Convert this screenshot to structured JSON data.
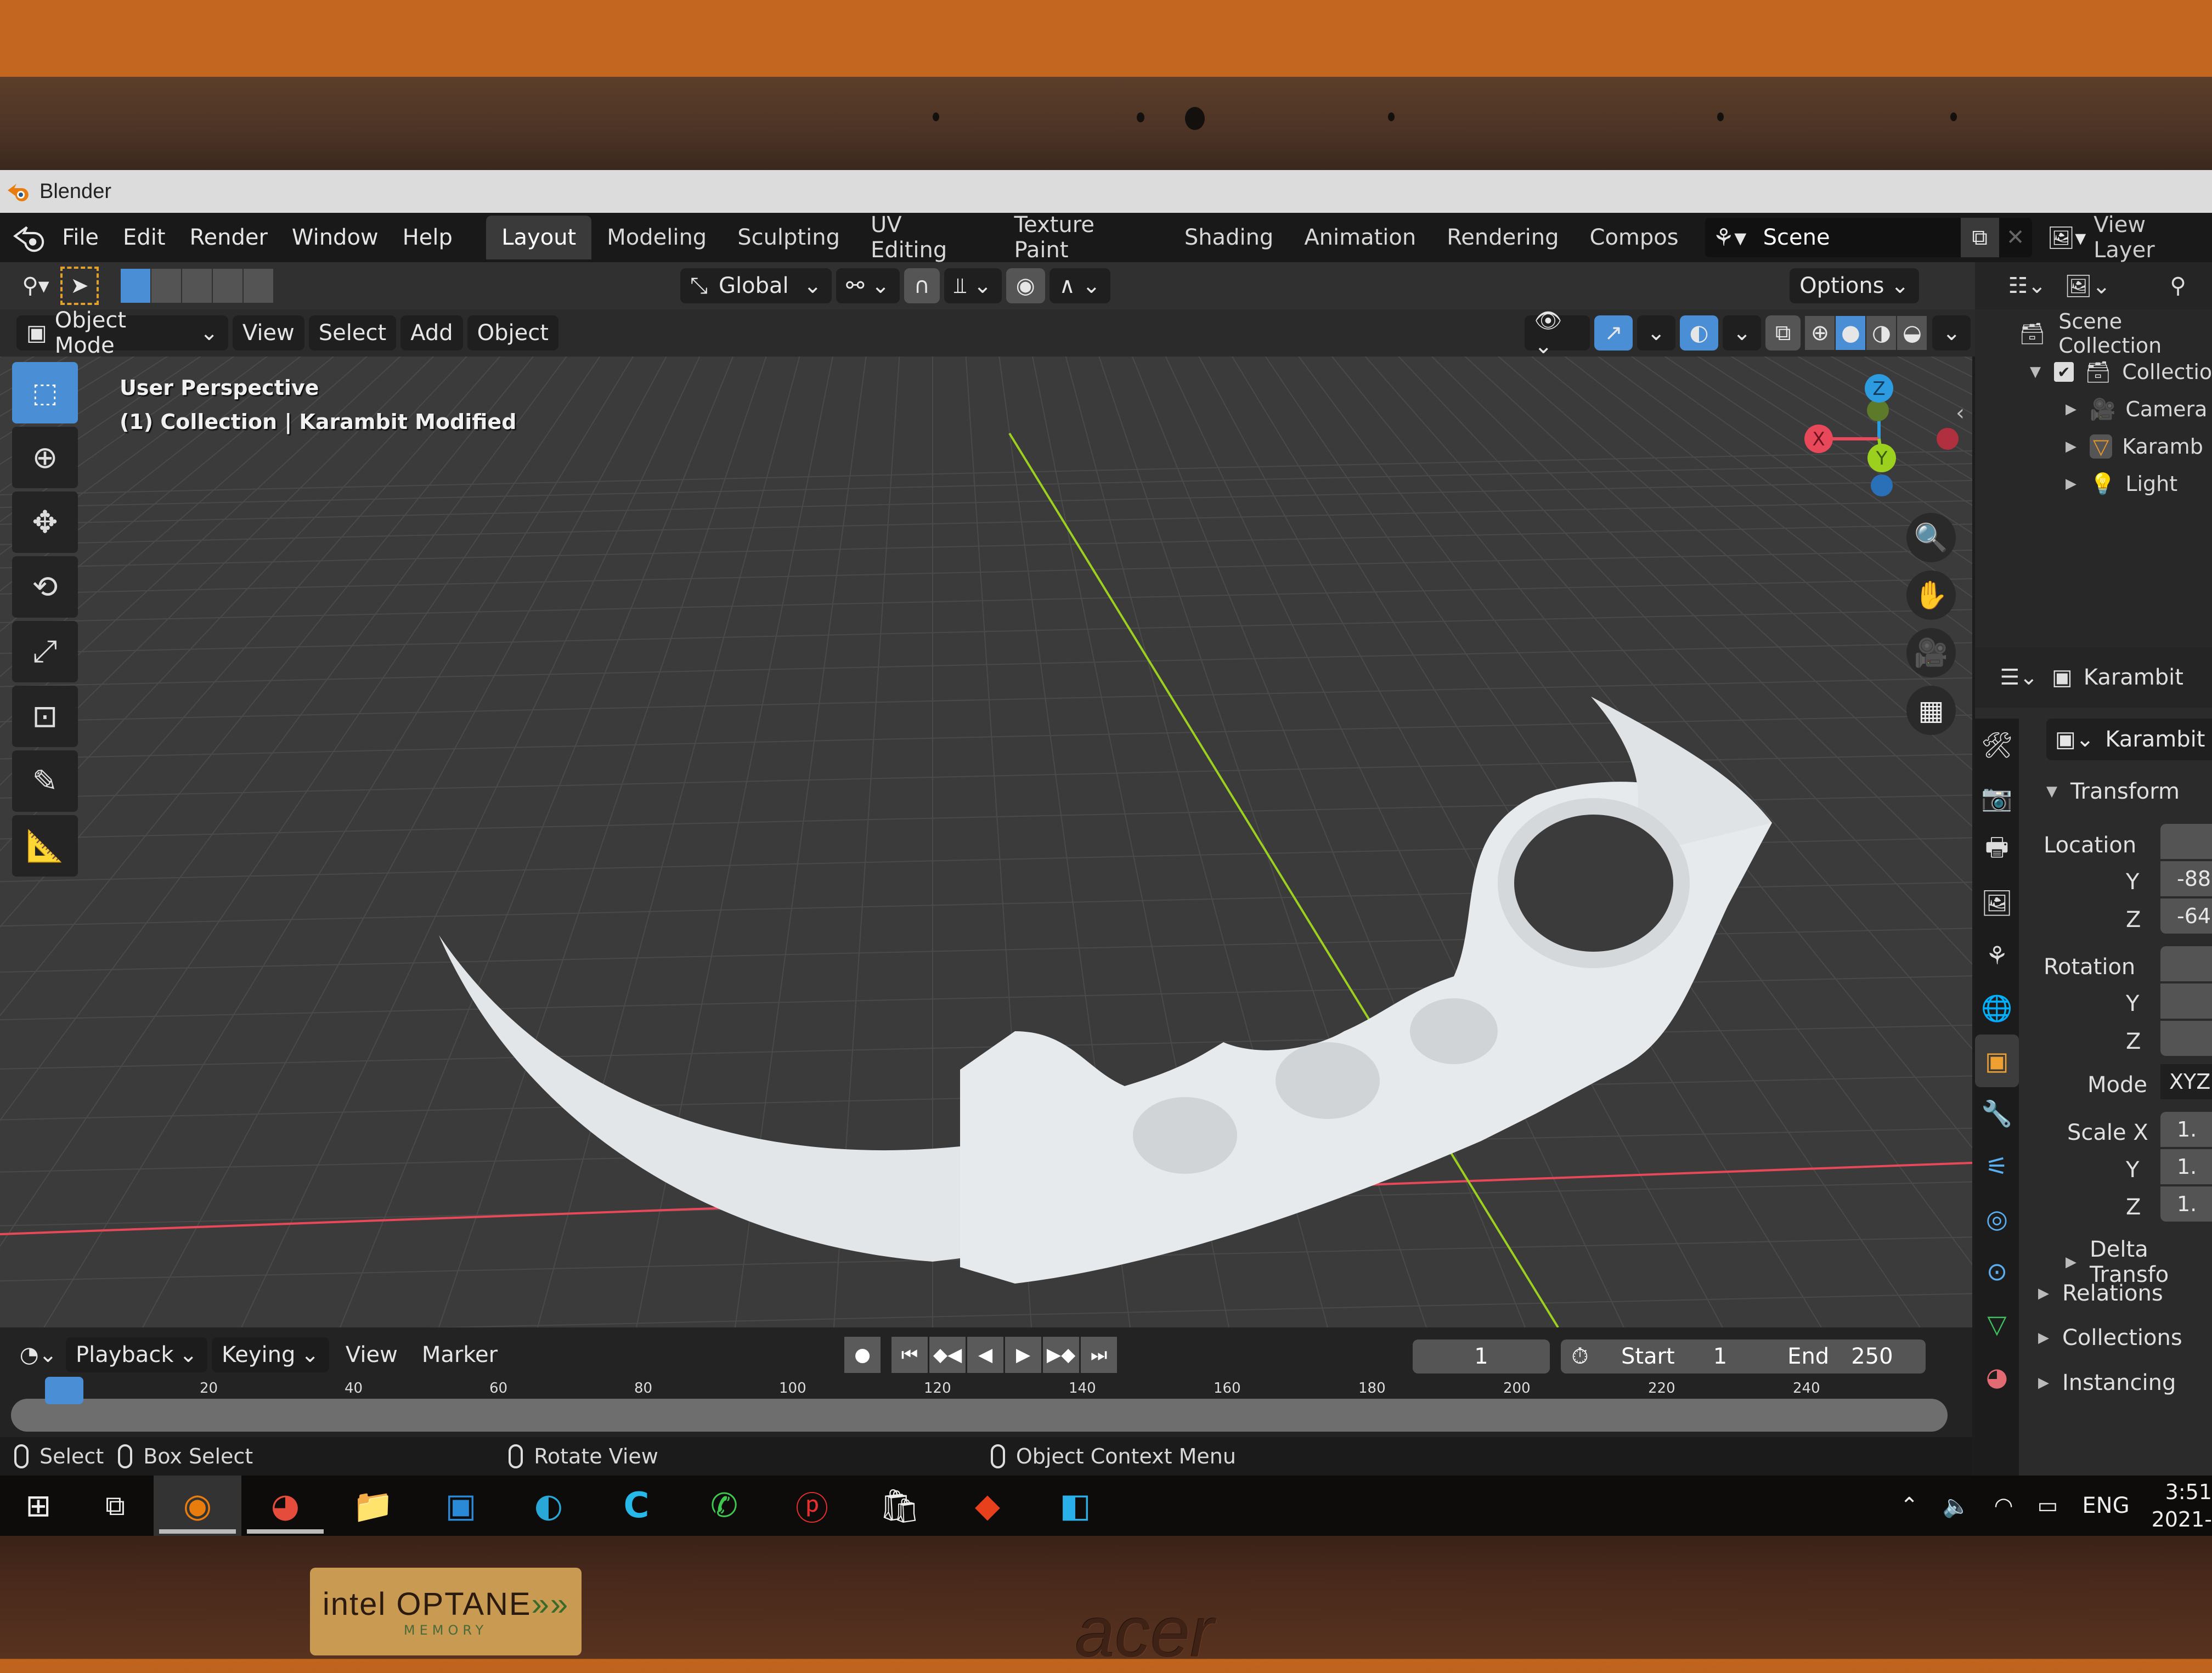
{
  "photo": {
    "sticker": {
      "brand": "intel",
      "product": "OPTANE",
      "chevrons": "»»",
      "subtitle": "MEMORY"
    },
    "laptop_brand": "acer"
  },
  "window": {
    "title": "Blender"
  },
  "menubar": {
    "items": [
      "File",
      "Edit",
      "Render",
      "Window",
      "Help"
    ]
  },
  "workspaces": {
    "active": "Layout",
    "tabs": [
      "Layout",
      "Modeling",
      "Sculpting",
      "UV Editing",
      "Texture Paint",
      "Shading",
      "Animation",
      "Rendering",
      "Compos"
    ]
  },
  "scene": {
    "name": "Scene",
    "view_layer": "View Layer"
  },
  "tool_header": {
    "transform_orientation": "Global",
    "options_label": "Options"
  },
  "view_header": {
    "mode": "Object Mode",
    "menus": [
      "View",
      "Select",
      "Add",
      "Object"
    ]
  },
  "viewport": {
    "perspective_label": "User Perspective",
    "object_info": "(1) Collection | Karambit Modified",
    "gizmo_axes": {
      "x": "X",
      "y": "Y",
      "z": "Z"
    },
    "colors": {
      "x_axis": "#e8495a",
      "y_axis": "#9bd01f",
      "z_axis": "#2d9be0",
      "grid": "#4a4a4a",
      "background": "#3b3b3b",
      "model": "#e4e8ea"
    }
  },
  "toolbar": {
    "tools": [
      "select-box",
      "cursor",
      "move",
      "rotate",
      "scale",
      "transform",
      "annotate",
      "measure"
    ],
    "active": "select-box"
  },
  "timeline": {
    "menus": [
      "Playback",
      "Keying",
      "View",
      "Marker"
    ],
    "current_frame": "1",
    "start_label": "Start",
    "start": "1",
    "end_label": "End",
    "end": "250",
    "ruler_ticks": [
      "20",
      "40",
      "60",
      "80",
      "100",
      "120",
      "140",
      "160",
      "180",
      "200",
      "220",
      "240"
    ]
  },
  "statusbar": {
    "left_click": "Select",
    "drag": "Box Select",
    "middle": "Rotate View",
    "right": "Object Context Menu"
  },
  "outliner": {
    "root": "Scene Collection",
    "collection": "Collection",
    "collection_checked": true,
    "objects": [
      {
        "name": "Camera",
        "icon": "camera-icon"
      },
      {
        "name": "Karamb",
        "icon": "mesh-icon"
      },
      {
        "name": "Light",
        "icon": "light-icon"
      }
    ]
  },
  "properties": {
    "context_object": "Karambit",
    "object_name": "Karambit",
    "transform_label": "Transform",
    "location_label": "Location",
    "location": {
      "x": "",
      "y": "-88",
      "z": "-64"
    },
    "rotation_label": "Rotation",
    "rotation": {
      "x": "",
      "y": "",
      "z": ""
    },
    "mode_label": "Mode",
    "mode_value": "XYZ",
    "scale_label": "Scale X",
    "scale": {
      "x": "1.",
      "y": "1.",
      "z": "1."
    },
    "axis_labels": {
      "y": "Y",
      "z": "Z"
    },
    "collapsed_panels": [
      "Delta Transfo",
      "Relations",
      "Collections",
      "Instancing"
    ]
  },
  "taskbar": {
    "apps": [
      "windows-start",
      "task-view",
      "blender",
      "chrome",
      "file-explorer",
      "camera-app",
      "edge",
      "c-app",
      "whatsapp",
      "pinterest",
      "microsoft-store",
      "roblox",
      "windows-app"
    ],
    "active_app": "blender",
    "language": "ENG",
    "time": "3:51",
    "date": "2021-"
  }
}
